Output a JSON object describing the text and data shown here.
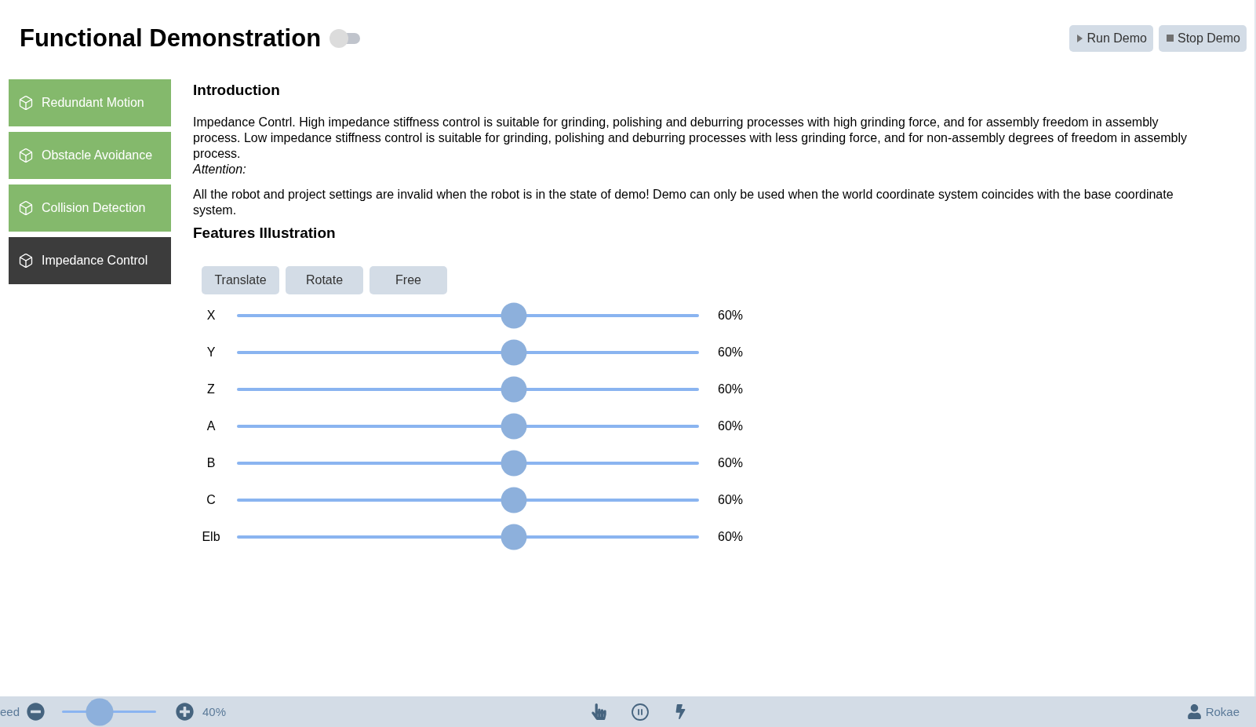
{
  "header": {
    "title": "Functional Demonstration",
    "toggle": {
      "on": false
    },
    "buttons": [
      {
        "kind": "run",
        "label": "Run Demo"
      },
      {
        "kind": "stop",
        "label": "Stop Demo"
      }
    ]
  },
  "sidebar": {
    "items": [
      {
        "label": "Redundant Motion",
        "selected": false
      },
      {
        "label": "Obstacle Avoidance",
        "selected": false
      },
      {
        "label": "Collision Detection",
        "selected": false
      },
      {
        "label": "Impedance Control",
        "selected": true
      }
    ]
  },
  "content": {
    "introduction": {
      "heading": "Introduction",
      "description": "Impedance Contrl. High impedance stiffness control is suitable for grinding, polishing and deburring processes with high grinding force, and for assembly freedom in assembly process. Low impedance stiffness control is suitable for grinding, polishing and deburring processes with less grinding force, and for non-assembly degrees of freedom in assembly process.",
      "attention_label": "Attention:",
      "attention_text": "All the robot and project settings are invalid when the robot is in the state of demo! Demo can only be used when the world coordinate system coincides with the base coordinate system."
    },
    "features": {
      "heading": "Features Illustration",
      "modes": [
        "Translate",
        "Rotate",
        "Free"
      ],
      "sliders": [
        {
          "label": "X",
          "level": 0.6,
          "reading": "60%"
        },
        {
          "label": "Y",
          "level": 0.6,
          "reading": "60%"
        },
        {
          "label": "Z",
          "level": 0.6,
          "reading": "60%"
        },
        {
          "label": "A",
          "level": 0.6,
          "reading": "60%"
        },
        {
          "label": "B",
          "level": 0.6,
          "reading": "60%"
        },
        {
          "label": "C",
          "level": 0.6,
          "reading": "60%"
        },
        {
          "label": "Elb",
          "level": 0.6,
          "reading": "60%"
        }
      ]
    }
  },
  "status_bar": {
    "speed_label": "eed",
    "speed": {
      "level": 0.4
    },
    "speed_reading": "40%",
    "user": "Rokae"
  }
}
